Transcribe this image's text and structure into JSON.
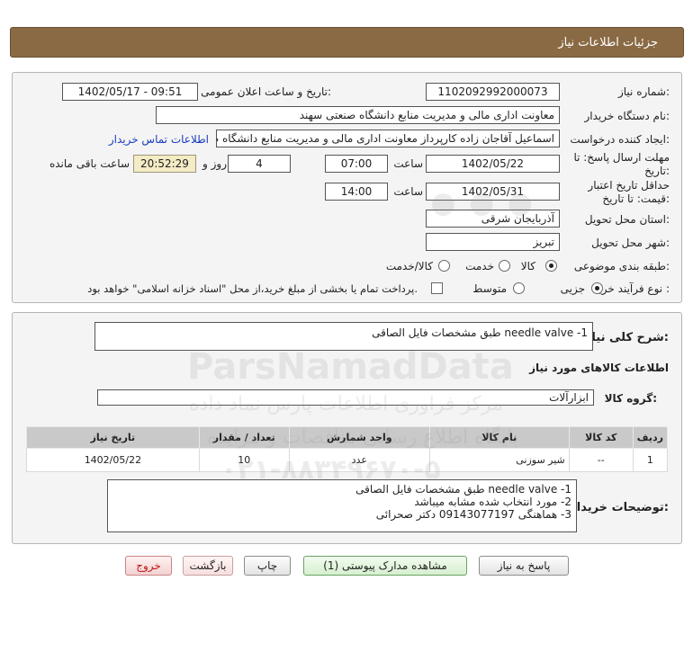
{
  "header": {
    "title": "جزئیات اطلاعات نیاز"
  },
  "form": {
    "need_number_label": "شماره نیاز:",
    "need_number": "1102092992000073",
    "announce_label": "تاریخ و ساعت اعلان عمومی:",
    "announce_value": "1402/05/17 - 09:51",
    "buyer_org_label": "نام دستگاه خریدار:",
    "buyer_org": "معاونت اداری  مالی و مدیریت منابع دانشگاه صنعتی سهند",
    "requester_label": "ایجاد کننده درخواست:",
    "requester": "اسماعیل آقاجان زاده کارپرداز معاونت اداری  مالی و مدیریت منابع دانشگاه صنعتی",
    "contact_link": "اطلاعات تماس خریدار",
    "reply_deadline_label_1": "مهلت ارسال پاسخ: تا",
    "reply_deadline_label_2": "تاریخ:",
    "reply_date": "1402/05/22",
    "time_label": "ساعت",
    "reply_time": "07:00",
    "days_value": "4",
    "days_label": "روز و",
    "remaining_time": "20:52:29",
    "remaining_label": "ساعت باقی مانده",
    "validity_label_1": "حداقل تاریخ اعتبار",
    "validity_label_2": "قیمت: تا تاریخ:",
    "validity_date": "1402/05/31",
    "validity_time": "14:00",
    "province_label": "استان محل تحویل:",
    "province": "آذربایجان شرقی",
    "city_label": "شهر محل تحویل:",
    "city": "تبریز",
    "category_label": "طبقه بندی موضوعی:",
    "category_options": [
      "کالا",
      "خدمت",
      "کالا/خدمت"
    ],
    "category_selected": "کالا",
    "process_label": "نوع فرآیند خرید :",
    "process_options": [
      "جزیی",
      "متوسط"
    ],
    "process_selected": "جزیی",
    "payment_note": "پرداخت تمام یا بخشی از مبلغ خرید،از محل \"اسناد خزانه اسلامی\" خواهد بود."
  },
  "summary": {
    "description_label": "شرح کلی نیاز:",
    "description": "needle valve -1 طبق مشخصات فایل الصاقی",
    "goods_info_title": "اطلاعات کالاهای مورد نیاز",
    "goods_group_label": "گروه کالا:",
    "goods_group": "ابزارآلات"
  },
  "table": {
    "headers": [
      "ردیف",
      "کد کالا",
      "نام کالا",
      "واحد شمارش",
      "تعداد / مقدار",
      "تاریخ نیاز"
    ],
    "rows": [
      [
        "1",
        "--",
        "شیر سوزنی",
        "عدد",
        "10",
        "1402/05/22"
      ]
    ]
  },
  "buyer_notes": {
    "label": "توضیحات خریدار:",
    "lines": [
      "needle valve -1 طبق مشخصات فایل الصاقی",
      "2- مورد انتخاب شده مشابه میباشد",
      "3- هماهنگی 09143077197 دکتر صحرائی"
    ]
  },
  "buttons": {
    "reply": "پاسخ به نیاز",
    "attachments": "مشاهده مدارک پیوستی (1)",
    "print": "چاپ",
    "back": "بازگشت",
    "exit": "خروج"
  },
  "watermark": {
    "brand": "ParsNamadData",
    "line1": "مرکز فراوری اطلاعات پارس نماد داده",
    "line2": "پایگاه اطلاع رسانی مناقصات و مزایده",
    "phone": "۰۲۱-۸۸۳۴۹۶۷۰-۵"
  }
}
